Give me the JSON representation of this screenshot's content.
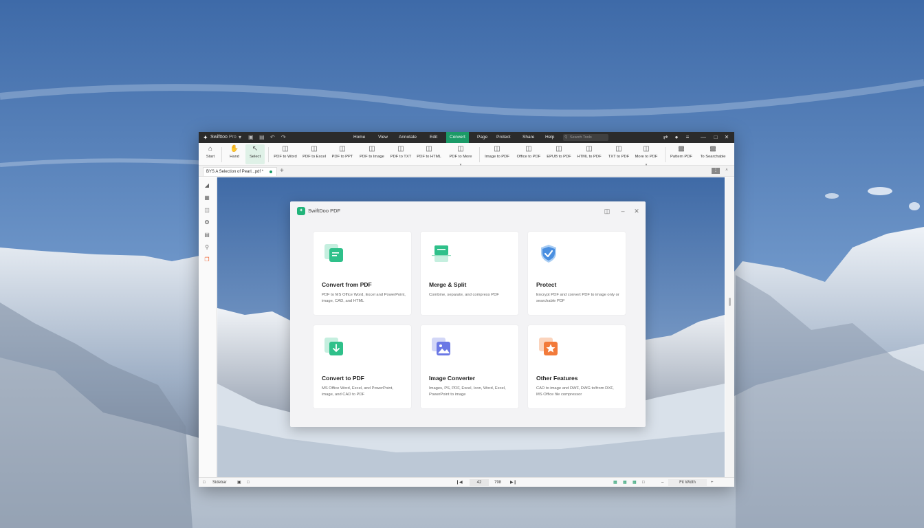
{
  "app": {
    "name": "Swifttoo",
    "name_suffix": "Pro",
    "colors": {
      "accent": "#1b9a67",
      "titlebar": "#2b2b2b"
    },
    "menus": [
      "Home",
      "View",
      "Annotate",
      "Edit",
      "Convert",
      "Page",
      "Protect",
      "Share",
      "Help"
    ],
    "active_menu": "Convert",
    "search_placeholder": "Search Tools"
  },
  "ribbon": {
    "tools": [
      {
        "label": "Start",
        "icon": "home-icon"
      },
      {
        "label": "Hand",
        "icon": "hand-icon"
      },
      {
        "label": "Select",
        "icon": "cursor-icon"
      },
      {
        "label": "PDF to Word",
        "icon": "file-convert-icon"
      },
      {
        "label": "PDF to Excel",
        "icon": "file-convert-icon"
      },
      {
        "label": "PDF to PPT",
        "icon": "file-convert-icon"
      },
      {
        "label": "PDF to Image",
        "icon": "file-convert-icon"
      },
      {
        "label": "PDF to TXT",
        "icon": "file-convert-icon"
      },
      {
        "label": "PDF to HTML",
        "icon": "file-convert-icon"
      },
      {
        "label": "PDF to More",
        "icon": "file-convert-icon"
      },
      {
        "label": "Image to PDF",
        "icon": "file-convert-icon"
      },
      {
        "label": "Office to PDF",
        "icon": "file-convert-icon"
      },
      {
        "label": "EPUB to PDF",
        "icon": "file-convert-icon"
      },
      {
        "label": "HTML to PDF",
        "icon": "file-convert-icon"
      },
      {
        "label": "TXT to PDF",
        "icon": "file-convert-icon"
      },
      {
        "label": "More to PDF",
        "icon": "file-convert-icon"
      },
      {
        "label": "Pattern PDF",
        "icon": "scan-icon"
      },
      {
        "label": "To Searchable",
        "icon": "search-doc-icon"
      }
    ]
  },
  "document": {
    "tab_title": "BYS A Selection of Pearl...pdf *",
    "add_tab": "+"
  },
  "status": {
    "sidebar_label": "Sidebar",
    "current_page": "42",
    "total_pages": "798",
    "zoom_label": "Fit Width"
  },
  "modal": {
    "title": "SwiftDoo PDF",
    "cards": [
      {
        "title": "Convert from PDF",
        "desc": "PDF to MS Office Word, Excel and PowerPoint, image, CAD, and HTML",
        "icon": "convert-from-pdf-icon",
        "color": "#2fc08a"
      },
      {
        "title": "Merge & Split",
        "desc": "Combine, separate, and compress PDF",
        "icon": "merge-split-icon",
        "color": "#2fc08a"
      },
      {
        "title": "Protect",
        "desc": "Encrypt PDF and convert PDF to image only or searchable PDF",
        "icon": "shield-icon",
        "color": "#4a8fe0"
      },
      {
        "title": "Convert to PDF",
        "desc": "MS Office Word, Excel, and PowerPoint, image, and CAD to PDF",
        "icon": "convert-to-pdf-icon",
        "color": "#2fc08a"
      },
      {
        "title": "Image Converter",
        "desc": "Images, PS, PDF, Excel, Icon, Word, Excel, PowerPoint to image",
        "icon": "image-converter-icon",
        "color": "#6b78e5"
      },
      {
        "title": "Other Features",
        "desc": "CAD to image and DWF, DWG to/from DXF, MS Office file compressor",
        "icon": "star-icon",
        "color": "#f27a3a"
      }
    ]
  }
}
